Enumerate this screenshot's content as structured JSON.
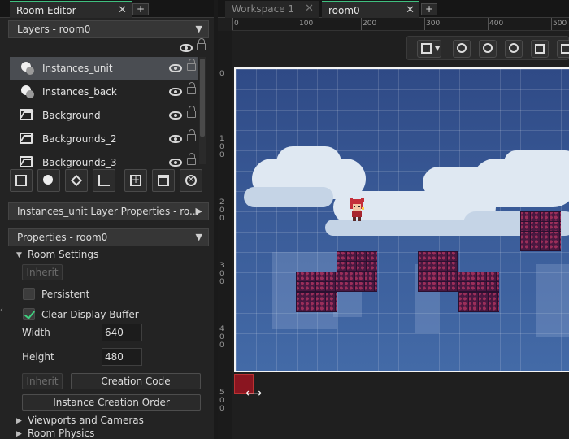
{
  "left_tabs": {
    "active": "Room Editor"
  },
  "layers_header": "Layers - room0",
  "layers": [
    {
      "label": "Instances_unit",
      "type": "instance",
      "selected": true
    },
    {
      "label": "Instances_back",
      "type": "instance",
      "selected": false
    },
    {
      "label": "Background",
      "type": "background",
      "selected": false
    },
    {
      "label": "Backgrounds_2",
      "type": "background",
      "selected": false
    },
    {
      "label": "Backgrounds_3",
      "type": "background",
      "selected": false
    }
  ],
  "layer_properties_header": "Instances_unit Layer Properties - ro...",
  "properties_header": "Properties - room0",
  "room_settings": {
    "section": "Room Settings",
    "inherit_label": "Inherit",
    "persistent_label": "Persistent",
    "persistent": false,
    "clear_display_label": "Clear Display Buffer",
    "clear_display": true,
    "width_label": "Width",
    "width": "640",
    "height_label": "Height",
    "height": "480",
    "inherit2_label": "Inherit",
    "creation_code_label": "Creation Code",
    "instance_order_label": "Instance Creation Order"
  },
  "collapsed_sections": [
    "Viewports and Cameras",
    "Room Physics"
  ],
  "workspace_tabs": [
    {
      "label": "Workspace 1",
      "active": false
    },
    {
      "label": "room0",
      "active": true
    }
  ],
  "ruler_h": [
    "0",
    "100",
    "200",
    "300",
    "400",
    "500"
  ],
  "ruler_v": [
    "0",
    "100",
    "200",
    "300",
    "400",
    "500"
  ],
  "colors": {
    "accent": "#3fbf7f",
    "selection": "#4a4d52",
    "marker": "#8a1520"
  }
}
